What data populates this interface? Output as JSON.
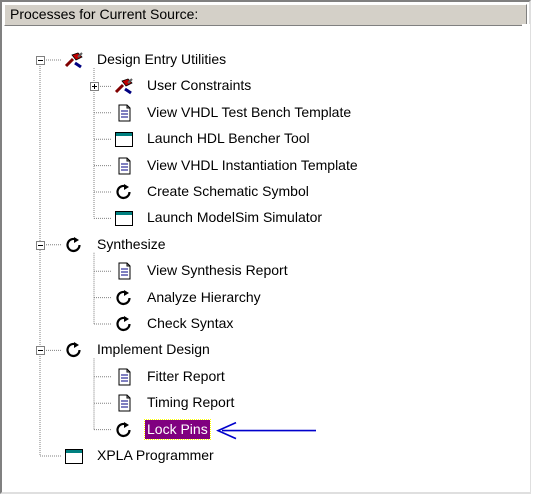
{
  "header": {
    "title": "Processes for Current Source:"
  },
  "colors": {
    "selection_bg": "#800080",
    "annotation_arrow": "#0000cc",
    "tree_lines": "#808080"
  },
  "tree": [
    {
      "label": "Design Entry Utilities",
      "icon": "utilities-tools-icon",
      "level": 0,
      "expander": "minus"
    },
    {
      "label": "User Constraints",
      "icon": "utilities-tools-icon",
      "level": 1,
      "expander": "plus"
    },
    {
      "label": "View VHDL Test Bench Template",
      "icon": "document-icon",
      "level": 1
    },
    {
      "label": "Launch HDL Bencher Tool",
      "icon": "window-icon",
      "level": 1
    },
    {
      "label": "View VHDL Instantiation Template",
      "icon": "document-icon",
      "level": 1
    },
    {
      "label": "Create Schematic Symbol",
      "icon": "run-process-icon",
      "level": 1
    },
    {
      "label": "Launch ModelSim Simulator",
      "icon": "window-icon",
      "level": 1
    },
    {
      "label": "Synthesize",
      "icon": "run-process-icon",
      "level": 0,
      "expander": "minus"
    },
    {
      "label": "View Synthesis Report",
      "icon": "document-icon",
      "level": 1
    },
    {
      "label": "Analyze Hierarchy",
      "icon": "run-process-icon",
      "level": 1
    },
    {
      "label": "Check Syntax",
      "icon": "run-process-icon",
      "level": 1
    },
    {
      "label": "Implement Design",
      "icon": "run-process-icon",
      "level": 0,
      "expander": "minus"
    },
    {
      "label": "Fitter Report",
      "icon": "document-icon",
      "level": 1
    },
    {
      "label": "Timing Report",
      "icon": "document-icon",
      "level": 1
    },
    {
      "label": "Lock Pins",
      "icon": "run-process-icon",
      "level": 1,
      "selected": true
    },
    {
      "label": "XPLA Programmer",
      "icon": "window-icon",
      "level": 0
    }
  ],
  "annotation": {
    "icon": "left-arrow-icon",
    "points_to": "Lock Pins"
  }
}
